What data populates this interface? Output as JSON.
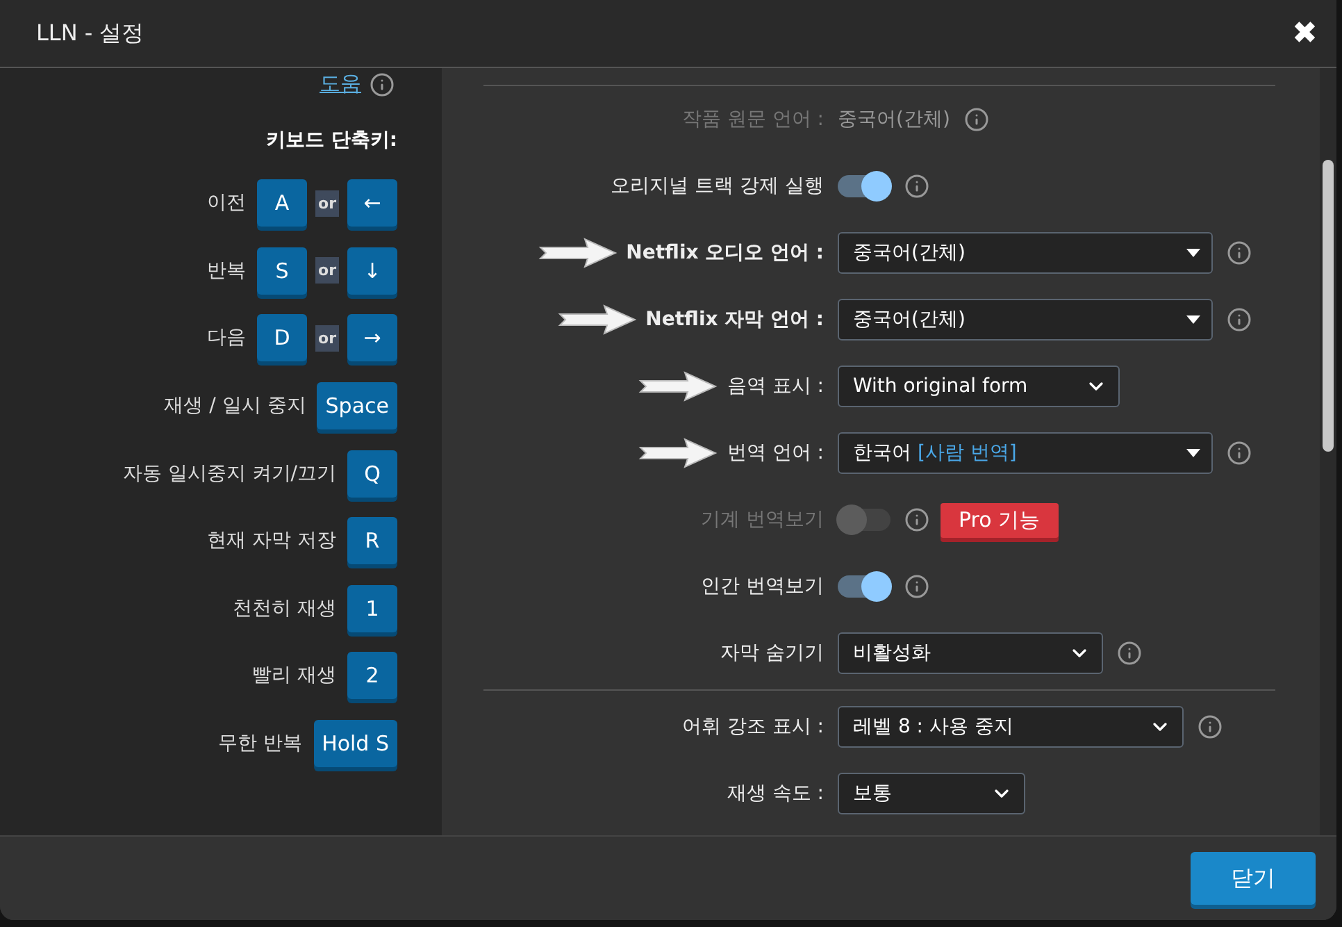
{
  "window": {
    "title": "LLN - 설정",
    "close": "✖"
  },
  "sidebar": {
    "help_link": "도움",
    "shortcuts_title": "키보드 단축키:",
    "shortcuts": [
      {
        "label": "이전",
        "keys": [
          "A",
          "←"
        ],
        "separator": "or"
      },
      {
        "label": "반복",
        "keys": [
          "S",
          "↓"
        ],
        "separator": "or"
      },
      {
        "label": "다음",
        "keys": [
          "D",
          "→"
        ],
        "separator": "or"
      },
      {
        "label": "재생 / 일시 중지",
        "keys": [
          "Space"
        ]
      },
      {
        "label": "자동 일시중지 켜기/끄기",
        "keys": [
          "Q"
        ]
      },
      {
        "label": "현재 자막 저장",
        "keys": [
          "R"
        ]
      },
      {
        "label": "천천히 재생",
        "keys": [
          "1"
        ]
      },
      {
        "label": "빨리 재생",
        "keys": [
          "2"
        ]
      },
      {
        "label": "무한 반복",
        "keys": [
          "Hold S"
        ]
      }
    ]
  },
  "settings": [
    {
      "kind": "text",
      "label": "작품 원문 언어 :",
      "value": "중국어(간체)",
      "disabled": true,
      "info": true
    },
    {
      "kind": "toggle",
      "label": "오리지널 트랙 강제 실행",
      "on": true,
      "disabled": false,
      "info": true
    },
    {
      "kind": "select",
      "label": "Netflix 오디오 언어 :",
      "value": "중국어(간체)",
      "arrow": true,
      "info": true
    },
    {
      "kind": "select",
      "label": "Netflix 자막 언어 :",
      "value": "중국어(간체)",
      "arrow": true,
      "info": true
    },
    {
      "kind": "dropdown",
      "label": "음역 표시 :",
      "value": "With original form",
      "arrow": true
    },
    {
      "kind": "select",
      "label": "번역 언어 :",
      "value": "한국어",
      "note": "[사람 번역]",
      "arrow": true,
      "info": true
    },
    {
      "kind": "toggle",
      "label": "기계 번역보기",
      "on": false,
      "disabled": true,
      "info": true,
      "badge": "Pro 기능"
    },
    {
      "kind": "toggle",
      "label": "인간 번역보기",
      "on": true,
      "disabled": false,
      "info": true
    },
    {
      "kind": "dropdown",
      "label": "자막 숨기기",
      "value": "비활성화",
      "info": true
    },
    {
      "kind": "divider"
    },
    {
      "kind": "dropdown",
      "label": "어휘 강조 표시 :",
      "value": "레벨 8 : 사용 중지",
      "info": true
    },
    {
      "kind": "dropdown",
      "label": "재생 속도 :",
      "value": "보통"
    }
  ],
  "footer": {
    "close_button": "닫기"
  }
}
